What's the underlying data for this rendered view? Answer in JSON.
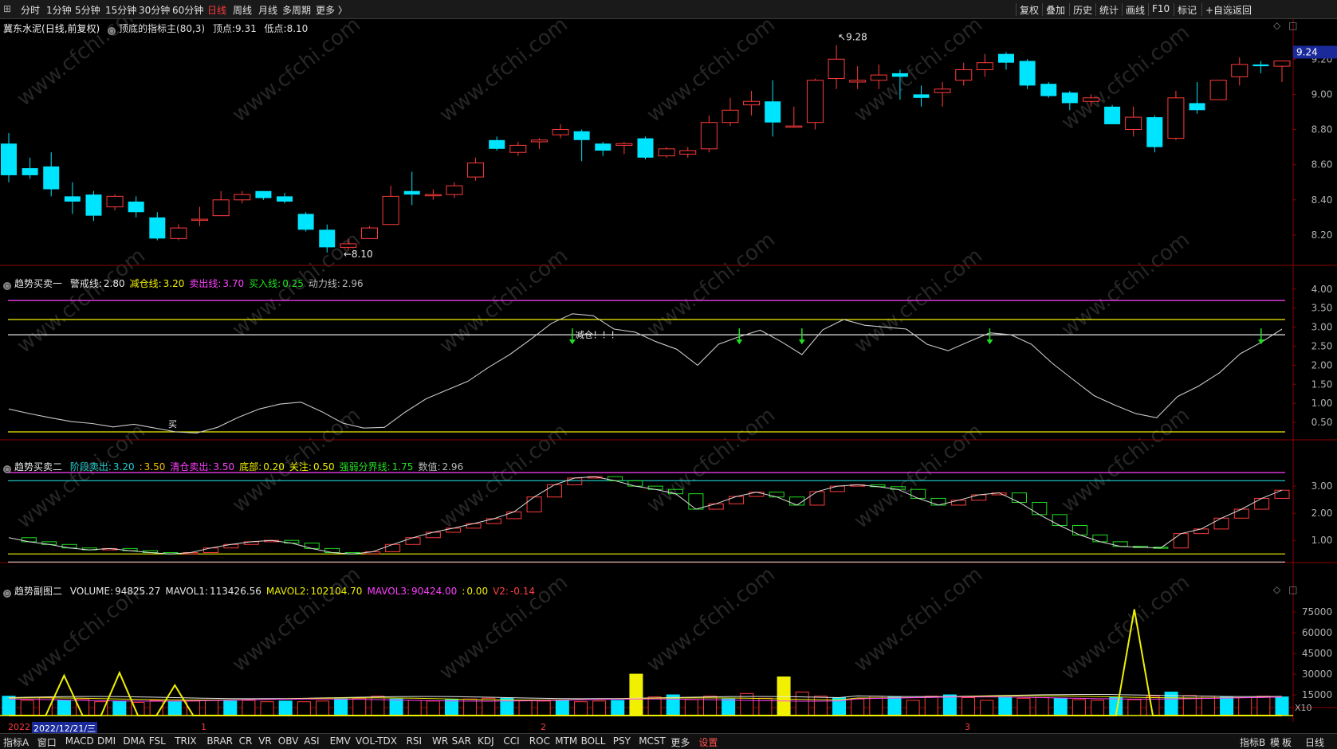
{
  "topbar": {
    "left_items": [
      "分时",
      "1分钟",
      "5分钟",
      "15分钟",
      "30分钟",
      "60分钟",
      "日线",
      "周线",
      "月线",
      "多周期",
      "更多 〉"
    ],
    "active": "日线",
    "right_items": [
      "复权",
      "叠加",
      "历史",
      "统计",
      "画线",
      "F10",
      "标记",
      "+自选",
      "返回"
    ]
  },
  "panel1": {
    "stock": "冀东水泥",
    "mode": "(日线,前复权)",
    "indicator": "顶底的指标主(80,3)",
    "top_label": "顶点:",
    "top_value": "9.31",
    "low_label": "低点:",
    "low_value": "8.10",
    "current_price": "9.24",
    "high_mark": "9.28",
    "low_mark": "8.10",
    "axis": [
      "9.20",
      "9.00",
      "8.80",
      "8.60",
      "8.40",
      "8.20"
    ]
  },
  "panel2": {
    "name": "趋势买卖一",
    "items": [
      {
        "label": "警戒线:",
        "value": "2.80",
        "color": "#e8e8e8"
      },
      {
        "label": "减仓线:",
        "value": "3.20",
        "color": "#f0f000"
      },
      {
        "label": "卖出线:",
        "value": "3.70",
        "color": "#ff40ff"
      },
      {
        "label": "买入线:",
        "value": "0.25",
        "color": "#20e020"
      },
      {
        "label": "动力线:",
        "value": "2.96",
        "color": "#bbbbbb"
      }
    ],
    "annotation": "减仓！！！",
    "buy_mark": "买",
    "axis": [
      "4.00",
      "3.50",
      "3.00",
      "2.50",
      "2.00",
      "1.50",
      "1.00",
      "0.50"
    ]
  },
  "panel3": {
    "name": "趋势买卖二",
    "items": [
      {
        "label": "阶段卖出:",
        "value": "3.20",
        "color": "#20d0d0"
      },
      {
        "label": ":",
        "value": "3.50",
        "color": "#f0c000"
      },
      {
        "label": "清仓卖出:",
        "value": "3.50",
        "color": "#ff40ff"
      },
      {
        "label": "底部:",
        "value": "0.20",
        "color": "#f0f000"
      },
      {
        "label": "关注:",
        "value": "0.50",
        "color": "#f0f000"
      },
      {
        "label": "强弱分界线:",
        "value": "1.75",
        "color": "#20e020"
      },
      {
        "label": "数值:",
        "value": "2.96",
        "color": "#bbbbbb"
      }
    ],
    "axis": [
      "3.00",
      "2.00",
      "1.00"
    ]
  },
  "panel4": {
    "name": "趋势副图二",
    "items": [
      {
        "label": "VOLUME:",
        "value": "94825.27",
        "color": "#e8e8e8"
      },
      {
        "label": "MAVOL1:",
        "value": "113426.56",
        "color": "#e8e8e8"
      },
      {
        "label": "MAVOL2:",
        "value": "102104.70",
        "color": "#f0f000"
      },
      {
        "label": "MAVOL3:",
        "value": "90424.00",
        "color": "#ff40ff"
      },
      {
        "label": ":",
        "value": "0.00",
        "color": "#f0f000"
      },
      {
        "label": "V2:",
        "value": "-0.14",
        "color": "#ff4040"
      }
    ],
    "axis": [
      "75000",
      "60000",
      "45000",
      "30000",
      "15000"
    ],
    "unit": "X10"
  },
  "datebar": {
    "year": "2022",
    "date": "2022/12/21/三",
    "months": [
      "1",
      "2",
      "3"
    ]
  },
  "bottombar": {
    "items": [
      "指标A",
      "窗口",
      "MACD",
      "DMI",
      "DMA",
      "FSL",
      "TRIX",
      "BRAR",
      "CR",
      "VR",
      "OBV",
      "ASI",
      "EMV",
      "VOL-TDX",
      "RSI",
      "WR",
      "SAR",
      "KDJ",
      "CCI",
      "ROC",
      "MTM",
      "BOLL",
      "PSY",
      "MCST",
      "更多",
      "设置"
    ],
    "right_items": [
      "指标B",
      "模",
      "板",
      "日线"
    ]
  },
  "watermark": "www.cfchi.com",
  "colors": {
    "up": "#ff3b3b",
    "down": "#00e5ff",
    "axis": "#8b0000",
    "white": "#e8e8e8",
    "yellow": "#f0f000",
    "magenta": "#ff40ff",
    "green": "#20e020",
    "cyan": "#20d0d0"
  },
  "chart_data": {
    "type": "candlestick",
    "candles": [
      {
        "o": 8.72,
        "c": 8.54,
        "h": 8.78,
        "l": 8.5
      },
      {
        "o": 8.58,
        "c": 8.54,
        "h": 8.64,
        "l": 8.52
      },
      {
        "o": 8.59,
        "c": 8.46,
        "h": 8.67,
        "l": 8.42
      },
      {
        "o": 8.42,
        "c": 8.39,
        "h": 8.5,
        "l": 8.32
      },
      {
        "o": 8.43,
        "c": 8.31,
        "h": 8.45,
        "l": 8.28
      },
      {
        "o": 8.36,
        "c": 8.42,
        "h": 8.43,
        "l": 8.34
      },
      {
        "o": 8.39,
        "c": 8.33,
        "h": 8.42,
        "l": 8.3
      },
      {
        "o": 8.3,
        "c": 8.18,
        "h": 8.33,
        "l": 8.17
      },
      {
        "o": 8.18,
        "c": 8.24,
        "h": 8.26,
        "l": 8.17
      },
      {
        "o": 8.29,
        "c": 8.29,
        "h": 8.36,
        "l": 8.25
      },
      {
        "o": 8.31,
        "c": 8.4,
        "h": 8.45,
        "l": 8.31
      },
      {
        "o": 8.4,
        "c": 8.43,
        "h": 8.45,
        "l": 8.38
      },
      {
        "o": 8.45,
        "c": 8.41,
        "h": 8.45,
        "l": 8.4
      },
      {
        "o": 8.42,
        "c": 8.39,
        "h": 8.44,
        "l": 8.38
      },
      {
        "o": 8.32,
        "c": 8.23,
        "h": 8.33,
        "l": 8.22
      },
      {
        "o": 8.23,
        "c": 8.13,
        "h": 8.26,
        "l": 8.1
      },
      {
        "o": 8.13,
        "c": 8.15,
        "h": 8.18,
        "l": 8.11
      },
      {
        "o": 8.18,
        "c": 8.24,
        "h": 8.25,
        "l": 8.18
      },
      {
        "o": 8.26,
        "c": 8.42,
        "h": 8.48,
        "l": 8.26
      },
      {
        "o": 8.45,
        "c": 8.43,
        "h": 8.56,
        "l": 8.37
      },
      {
        "o": 8.43,
        "c": 8.43,
        "h": 8.46,
        "l": 8.4
      },
      {
        "o": 8.43,
        "c": 8.48,
        "h": 8.5,
        "l": 8.41
      },
      {
        "o": 8.53,
        "c": 8.61,
        "h": 8.64,
        "l": 8.51
      },
      {
        "o": 8.74,
        "c": 8.69,
        "h": 8.76,
        "l": 8.68
      },
      {
        "o": 8.67,
        "c": 8.71,
        "h": 8.73,
        "l": 8.65
      },
      {
        "o": 8.73,
        "c": 8.74,
        "h": 8.75,
        "l": 8.69
      },
      {
        "o": 8.77,
        "c": 8.8,
        "h": 8.83,
        "l": 8.75
      },
      {
        "o": 8.79,
        "c": 8.74,
        "h": 8.8,
        "l": 8.62
      },
      {
        "o": 8.72,
        "c": 8.68,
        "h": 8.73,
        "l": 8.65
      },
      {
        "o": 8.71,
        "c": 8.72,
        "h": 8.73,
        "l": 8.66
      },
      {
        "o": 8.75,
        "c": 8.64,
        "h": 8.76,
        "l": 8.63
      },
      {
        "o": 8.65,
        "c": 8.69,
        "h": 8.7,
        "l": 8.64
      },
      {
        "o": 8.66,
        "c": 8.68,
        "h": 8.7,
        "l": 8.64
      },
      {
        "o": 8.69,
        "c": 8.84,
        "h": 8.88,
        "l": 8.67
      },
      {
        "o": 8.84,
        "c": 8.91,
        "h": 8.98,
        "l": 8.82
      },
      {
        "o": 8.94,
        "c": 8.96,
        "h": 9.02,
        "l": 8.88
      },
      {
        "o": 8.96,
        "c": 8.84,
        "h": 9.08,
        "l": 8.76
      },
      {
        "o": 8.82,
        "c": 8.82,
        "h": 8.93,
        "l": 8.81
      },
      {
        "o": 8.84,
        "c": 9.08,
        "h": 9.09,
        "l": 8.8
      },
      {
        "o": 9.09,
        "c": 9.2,
        "h": 9.28,
        "l": 9.03
      },
      {
        "o": 9.07,
        "c": 9.08,
        "h": 9.16,
        "l": 9.03
      },
      {
        "o": 9.08,
        "c": 9.11,
        "h": 9.17,
        "l": 9.03
      },
      {
        "o": 9.12,
        "c": 9.1,
        "h": 9.14,
        "l": 8.97
      },
      {
        "o": 9.0,
        "c": 8.98,
        "h": 9.05,
        "l": 8.93
      },
      {
        "o": 9.01,
        "c": 9.03,
        "h": 9.07,
        "l": 8.93
      },
      {
        "o": 9.08,
        "c": 9.14,
        "h": 9.18,
        "l": 9.05
      },
      {
        "o": 9.14,
        "c": 9.18,
        "h": 9.23,
        "l": 9.1
      },
      {
        "o": 9.23,
        "c": 9.18,
        "h": 9.24,
        "l": 9.14
      },
      {
        "o": 9.19,
        "c": 9.05,
        "h": 9.2,
        "l": 9.03
      },
      {
        "o": 9.06,
        "c": 8.99,
        "h": 9.07,
        "l": 8.98
      },
      {
        "o": 9.01,
        "c": 8.95,
        "h": 9.02,
        "l": 8.91
      },
      {
        "o": 8.96,
        "c": 8.98,
        "h": 9.0,
        "l": 8.93
      },
      {
        "o": 8.93,
        "c": 8.83,
        "h": 8.94,
        "l": 8.83
      },
      {
        "o": 8.8,
        "c": 8.87,
        "h": 8.93,
        "l": 8.76
      },
      {
        "o": 8.87,
        "c": 8.7,
        "h": 8.88,
        "l": 8.67
      },
      {
        "o": 8.75,
        "c": 8.98,
        "h": 9.02,
        "l": 8.74
      },
      {
        "o": 8.95,
        "c": 8.91,
        "h": 9.07,
        "l": 8.89
      },
      {
        "o": 8.97,
        "c": 9.08,
        "h": 9.08,
        "l": 8.97
      },
      {
        "o": 9.1,
        "c": 9.17,
        "h": 9.21,
        "l": 9.05
      },
      {
        "o": 9.17,
        "c": 9.16,
        "h": 9.19,
        "l": 9.12
      },
      {
        "o": 9.16,
        "c": 9.19,
        "h": 9.19,
        "l": 9.07
      }
    ],
    "power_line": [
      0.85,
      0.73,
      0.62,
      0.52,
      0.47,
      0.38,
      0.45,
      0.35,
      0.25,
      0.22,
      0.37,
      0.63,
      0.85,
      0.98,
      1.03,
      0.78,
      0.48,
      0.35,
      0.37,
      0.77,
      1.12,
      1.35,
      1.58,
      1.95,
      2.28,
      2.68,
      3.1,
      3.35,
      3.3,
      2.95,
      2.87,
      2.62,
      2.42,
      2.0,
      2.55,
      2.75,
      2.92,
      2.62,
      2.28,
      2.93,
      3.2,
      3.05,
      3.0,
      2.95,
      2.55,
      2.38,
      2.62,
      2.85,
      2.8,
      2.55,
      2.05,
      1.62,
      1.2,
      0.95,
      0.73,
      0.62,
      1.18,
      1.45,
      1.8,
      2.3,
      2.6,
      2.95
    ],
    "trend2": [
      1.1,
      0.95,
      0.85,
      0.72,
      0.65,
      0.7,
      0.62,
      0.55,
      0.5,
      0.55,
      0.72,
      0.85,
      0.95,
      1.0,
      0.9,
      0.7,
      0.55,
      0.5,
      0.58,
      0.85,
      1.1,
      1.3,
      1.45,
      1.62,
      1.8,
      2.05,
      2.6,
      3.05,
      3.3,
      3.35,
      3.2,
      3.0,
      2.88,
      2.72,
      2.15,
      2.35,
      2.62,
      2.78,
      2.6,
      2.3,
      2.8,
      3.0,
      3.05,
      2.98,
      2.88,
      2.55,
      2.3,
      2.48,
      2.68,
      2.75,
      2.4,
      1.95,
      1.55,
      1.2,
      0.95,
      0.78,
      0.75,
      0.72,
      1.25,
      1.42,
      1.82,
      2.15,
      2.55,
      2.85
    ],
    "volume": [
      14000,
      11000,
      13000,
      11000,
      12000,
      10000,
      10500,
      9500,
      11000,
      10000,
      10500,
      11000,
      10500,
      11000,
      10000,
      10500,
      10000,
      10500,
      12000,
      12500,
      14000,
      12000,
      11000,
      10500,
      11500,
      12000,
      12500,
      12500,
      11000,
      10500,
      11000,
      10000,
      10500,
      11000,
      30000,
      13500,
      15000,
      11500,
      14000,
      12000,
      16000,
      12500,
      28000,
      17000,
      14000,
      13000,
      12000,
      14000,
      13500,
      11000,
      14000,
      15000,
      13000,
      11000,
      13500,
      12500,
      13000,
      12500,
      11500,
      11000,
      13000,
      11500,
      14000,
      17000,
      14500,
      14000,
      13500,
      13000,
      14000,
      13500
    ],
    "yellow_spikes": [
      {
        "i": 3,
        "v": 29000
      },
      {
        "i": 6,
        "v": 31000
      },
      {
        "i": 9,
        "v": 22000
      },
      {
        "i": 61,
        "v": 77000
      }
    ]
  }
}
